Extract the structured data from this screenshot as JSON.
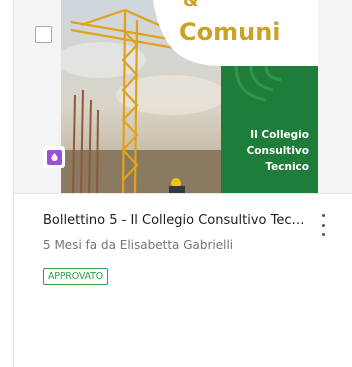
{
  "card": {
    "thumbnail": {
      "banner_top": "Comuni",
      "panel_lines": [
        "Il Collegio",
        "Consultivo",
        "Tecnico"
      ]
    },
    "file_type_icon": "document-icon",
    "title": "Bollettino 5 - Il Collegio Consultivo Tecnico",
    "meta": "5 Mesi fa da Elisabetta Gabrielli",
    "status": "APPROVATO",
    "menu_icon": "kebab-menu-icon"
  },
  "colors": {
    "status_green": "#2e9d4a",
    "file_badge_purple": "#9b4fdc",
    "banner_gold": "#c9a227",
    "panel_green": "#1e7d3a"
  }
}
